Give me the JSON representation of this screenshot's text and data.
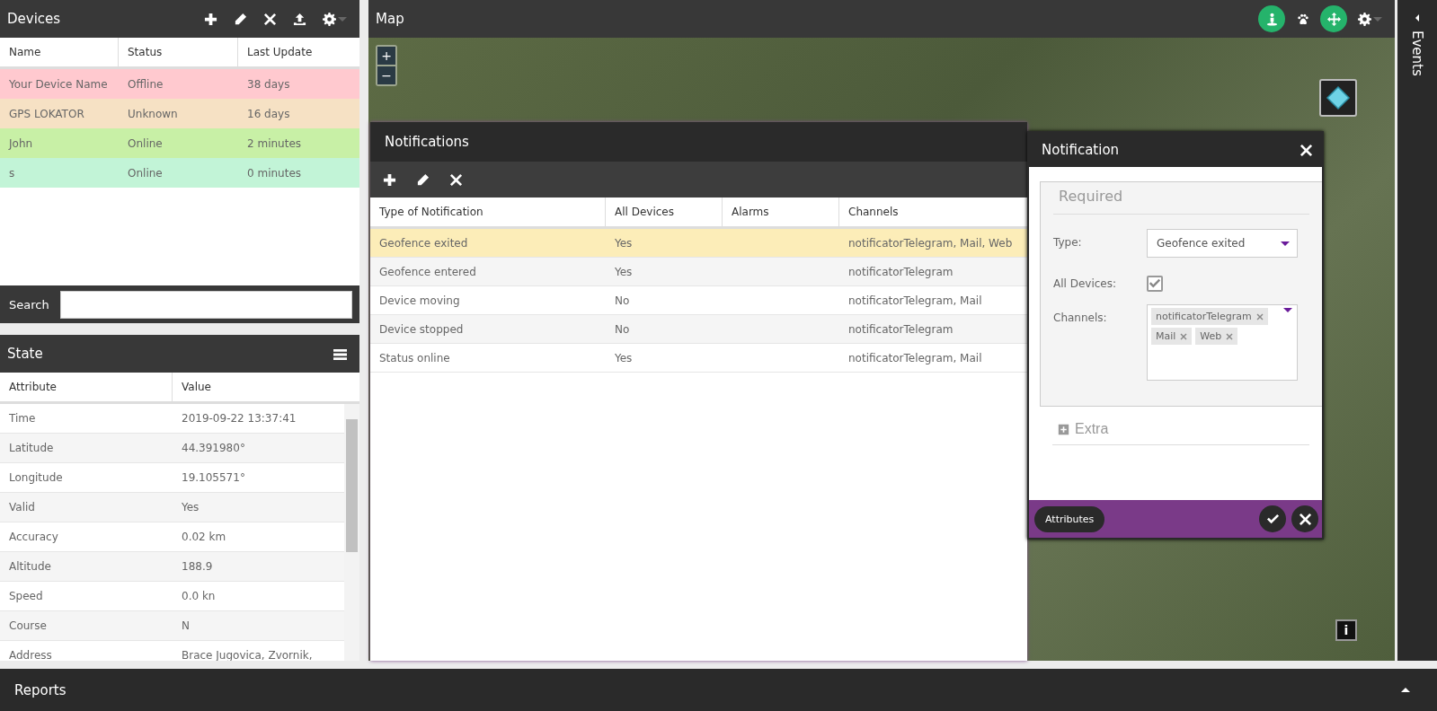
{
  "devices": {
    "title": "Devices",
    "columns": [
      "Name",
      "Status",
      "Last Update"
    ],
    "rows": [
      {
        "cells": [
          "Your Device Name",
          "Offline",
          "38 days"
        ],
        "color": "#ffc9cf"
      },
      {
        "cells": [
          "GPS LOKATOR",
          "Unknown",
          "16 days"
        ],
        "color": "#f6e1c4"
      },
      {
        "cells": [
          "John",
          "Online",
          "2 minutes"
        ],
        "color": "#c8f0a6"
      },
      {
        "cells": [
          "s",
          "Online",
          "0 minutes"
        ],
        "color": "#c2f4d7"
      }
    ],
    "search_label": "Search"
  },
  "state": {
    "title": "State",
    "columns": [
      "Attribute",
      "Value"
    ],
    "rows": [
      {
        "attribute": "Time",
        "value": "2019-09-22 13:37:41"
      },
      {
        "attribute": "Latitude",
        "value": "44.391980°"
      },
      {
        "attribute": "Longitude",
        "value": "19.105571°"
      },
      {
        "attribute": "Valid",
        "value": "Yes"
      },
      {
        "attribute": "Accuracy",
        "value": "0.02 km"
      },
      {
        "attribute": "Altitude",
        "value": "188.9"
      },
      {
        "attribute": "Speed",
        "value": "0.0 kn"
      },
      {
        "attribute": "Course",
        "value": "N"
      },
      {
        "attribute": "Address",
        "value": "Brace Jugovica, Zvornik,"
      }
    ]
  },
  "map": {
    "title": "Map",
    "zoom_in": "+",
    "zoom_out": "−",
    "info": "i"
  },
  "events": {
    "title": "Events"
  },
  "reports": {
    "title": "Reports"
  },
  "notifications": {
    "title": "Notifications",
    "columns": [
      "Type of Notification",
      "All Devices",
      "Alarms",
      "Channels"
    ],
    "rows": [
      {
        "type": "Geofence exited",
        "all_devices": "Yes",
        "channels": "notificatorTelegram, Mail, Web",
        "selected": true
      },
      {
        "type": "Geofence entered",
        "all_devices": "Yes",
        "channels": "notificatorTelegram",
        "selected": false
      },
      {
        "type": "Device moving",
        "all_devices": "No",
        "channels": "notificatorTelegram, Mail",
        "selected": false
      },
      {
        "type": "Device stopped",
        "all_devices": "No",
        "channels": "notificatorTelegram",
        "selected": false
      },
      {
        "type": "Status online",
        "all_devices": "Yes",
        "channels": "notificatorTelegram, Mail",
        "selected": false
      }
    ]
  },
  "dialog": {
    "title": "Notification",
    "required_legend": "Required",
    "fields": [
      {
        "kind": "select",
        "label": "Type:",
        "value": "Geofence exited"
      },
      {
        "kind": "checkbox",
        "label": "All Devices:",
        "checked": true
      },
      {
        "kind": "tags",
        "label": "Channels:",
        "tags": [
          "notificatorTelegram",
          "Mail",
          "Web"
        ]
      }
    ],
    "extra_legend": "Extra",
    "attributes_button": "Attributes"
  }
}
